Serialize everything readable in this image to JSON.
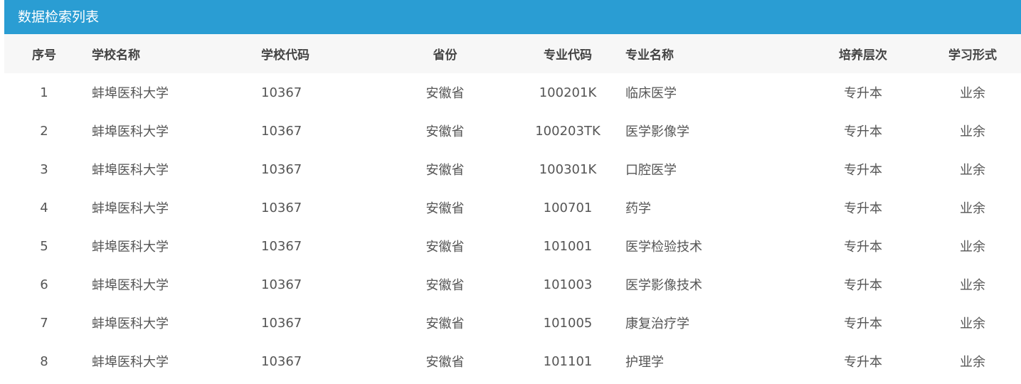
{
  "panel": {
    "title": "数据检索列表"
  },
  "colors": {
    "header_bg": "#2a9dd3",
    "header_text": "#ffffff",
    "table_head_bg": "#f7f7f7"
  },
  "table": {
    "columns": [
      "序号",
      "学校名称",
      "学校代码",
      "省份",
      "专业代码",
      "专业名称",
      "培养层次",
      "学习形式"
    ],
    "rows": [
      [
        "1",
        "蚌埠医科大学",
        "10367",
        "安徽省",
        "100201K",
        "临床医学",
        "专升本",
        "业余"
      ],
      [
        "2",
        "蚌埠医科大学",
        "10367",
        "安徽省",
        "100203TK",
        "医学影像学",
        "专升本",
        "业余"
      ],
      [
        "3",
        "蚌埠医科大学",
        "10367",
        "安徽省",
        "100301K",
        "口腔医学",
        "专升本",
        "业余"
      ],
      [
        "4",
        "蚌埠医科大学",
        "10367",
        "安徽省",
        "100701",
        "药学",
        "专升本",
        "业余"
      ],
      [
        "5",
        "蚌埠医科大学",
        "10367",
        "安徽省",
        "101001",
        "医学检验技术",
        "专升本",
        "业余"
      ],
      [
        "6",
        "蚌埠医科大学",
        "10367",
        "安徽省",
        "101003",
        "医学影像技术",
        "专升本",
        "业余"
      ],
      [
        "7",
        "蚌埠医科大学",
        "10367",
        "安徽省",
        "101005",
        "康复治疗学",
        "专升本",
        "业余"
      ],
      [
        "8",
        "蚌埠医科大学",
        "10367",
        "安徽省",
        "101101",
        "护理学",
        "专升本",
        "业余"
      ]
    ]
  }
}
